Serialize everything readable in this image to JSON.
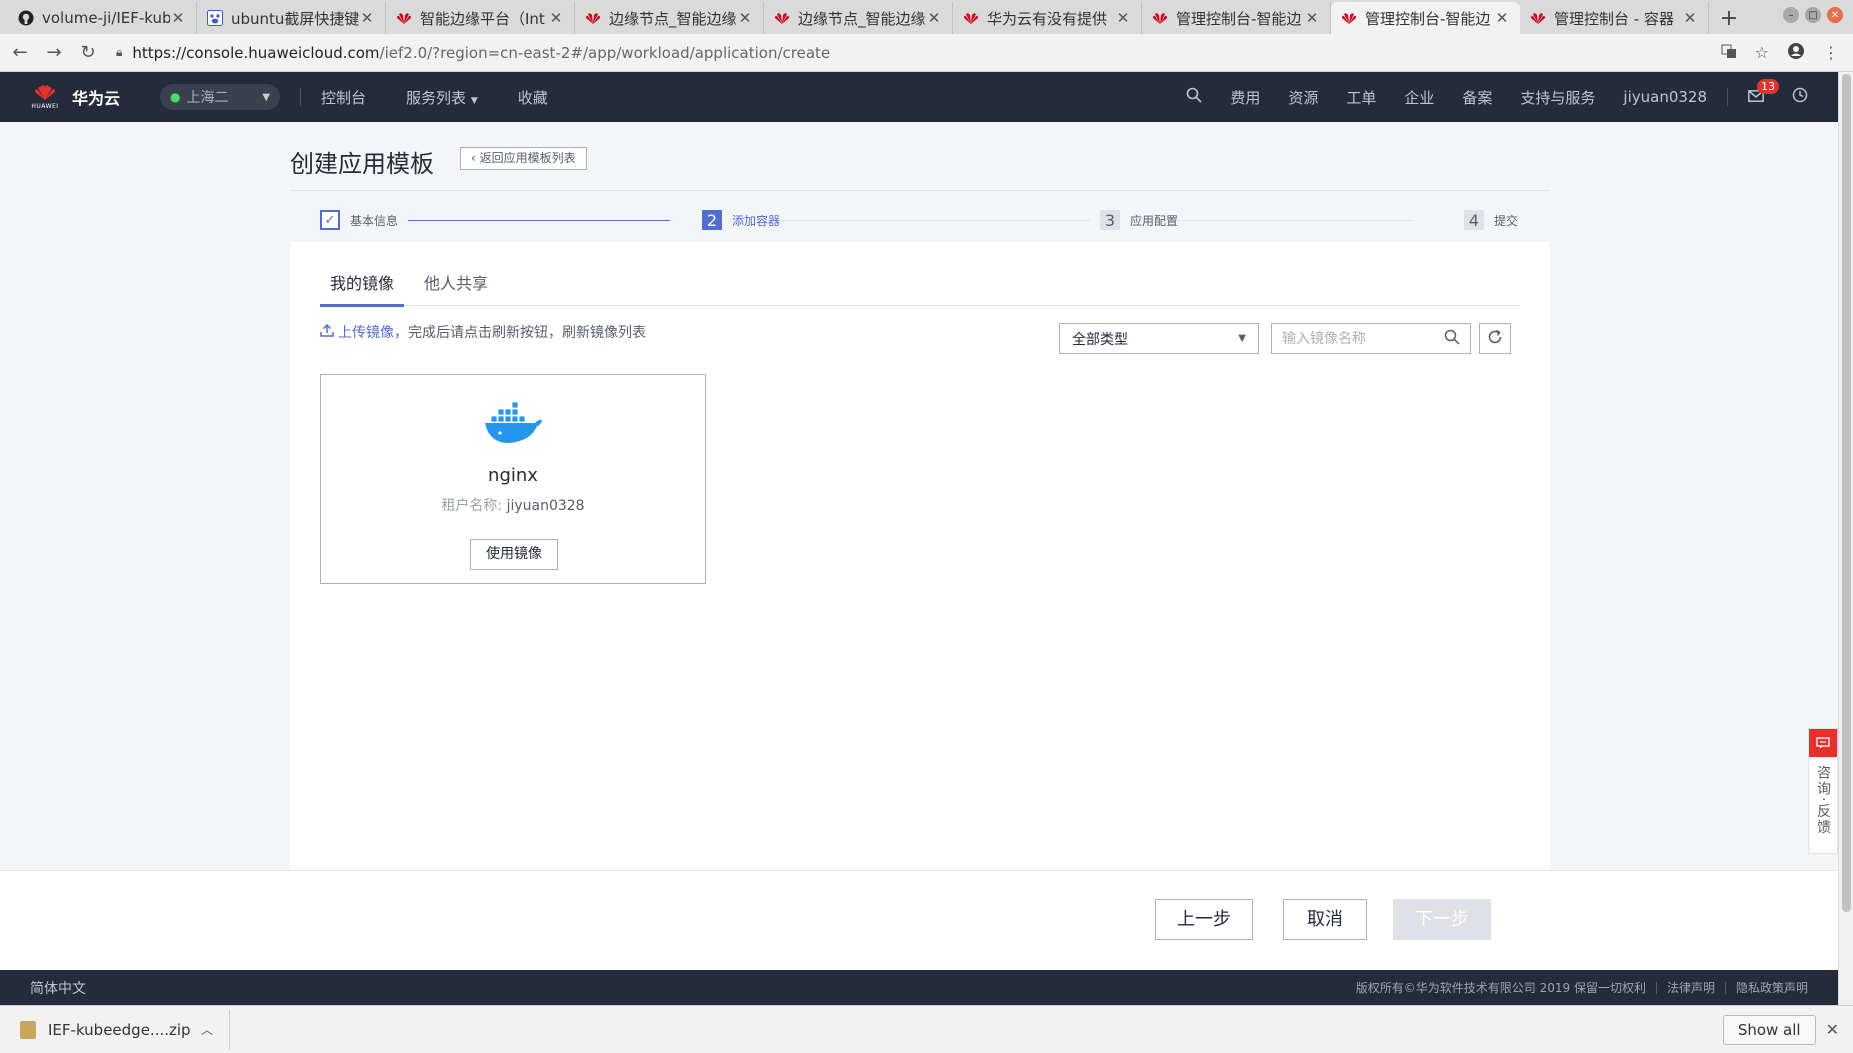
{
  "browser": {
    "tabs": [
      {
        "title": "volume-ji/IEF-kub",
        "icon": "github-icon",
        "active": false
      },
      {
        "title": "ubuntu截屏快捷键",
        "icon": "baidu-icon",
        "active": false
      },
      {
        "title": "智能边缘平台（Int",
        "icon": "huawei-icon",
        "active": false
      },
      {
        "title": "边缘节点_智能边缘",
        "icon": "huawei-icon",
        "active": false
      },
      {
        "title": "边缘节点_智能边缘",
        "icon": "huawei-icon",
        "active": false
      },
      {
        "title": "华为云有没有提供",
        "icon": "huawei-icon",
        "active": false
      },
      {
        "title": "管理控制台-智能边",
        "icon": "huawei-icon",
        "active": false
      },
      {
        "title": "管理控制台-智能边",
        "icon": "huawei-icon",
        "active": true
      },
      {
        "title": "管理控制台 - 容器",
        "icon": "huawei-icon",
        "active": false
      }
    ],
    "url_host": "https://console.huaweicloud.com",
    "url_path": "/ief2.0/?region=cn-east-2#/app/workload/application/create"
  },
  "header": {
    "brand": "华为云",
    "logo_text": "HUAWEI",
    "region": "上海二",
    "nav": [
      "控制台",
      "服务列表",
      "收藏"
    ],
    "right_items": [
      "费用",
      "资源",
      "工单",
      "企业",
      "备案",
      "支持与服务"
    ],
    "username": "jiyuan0328",
    "mail_badge": "13"
  },
  "page": {
    "title": "创建应用模板",
    "back_label": "返回应用模板列表",
    "steps": [
      {
        "num": "1",
        "label": "基本信息",
        "state": "done"
      },
      {
        "num": "2",
        "label": "添加容器",
        "state": "active"
      },
      {
        "num": "3",
        "label": "应用配置",
        "state": "todo"
      },
      {
        "num": "4",
        "label": "提交",
        "state": "todo"
      }
    ],
    "tabs": [
      "我的镜像",
      "他人共享"
    ],
    "upload_link": "上传镜像",
    "upload_hint": "，完成后请点击刷新按钮，刷新镜像列表",
    "type_filter": "全部类型",
    "search_placeholder": "输入镜像名称",
    "image": {
      "name": "nginx",
      "tenant_label": "租户名称:",
      "tenant_value": "jiyuan0328",
      "use_label": "使用镜像"
    },
    "footer_buttons": {
      "prev": "上一步",
      "cancel": "取消",
      "next": "下一步"
    }
  },
  "side_consult": "咨询·反馈",
  "site_footer": {
    "lang": "简体中文",
    "copyright": "版权所有©华为软件技术有限公司 2019 保留一切权利",
    "legal": "法律声明",
    "privacy": "隐私政策声明"
  },
  "downloads": {
    "file": "IEF-kubeedge....zip",
    "show_all": "Show all"
  },
  "colors": {
    "primary": "#526ecc",
    "header_bg": "#252b3a",
    "badge": "#e4312b"
  }
}
